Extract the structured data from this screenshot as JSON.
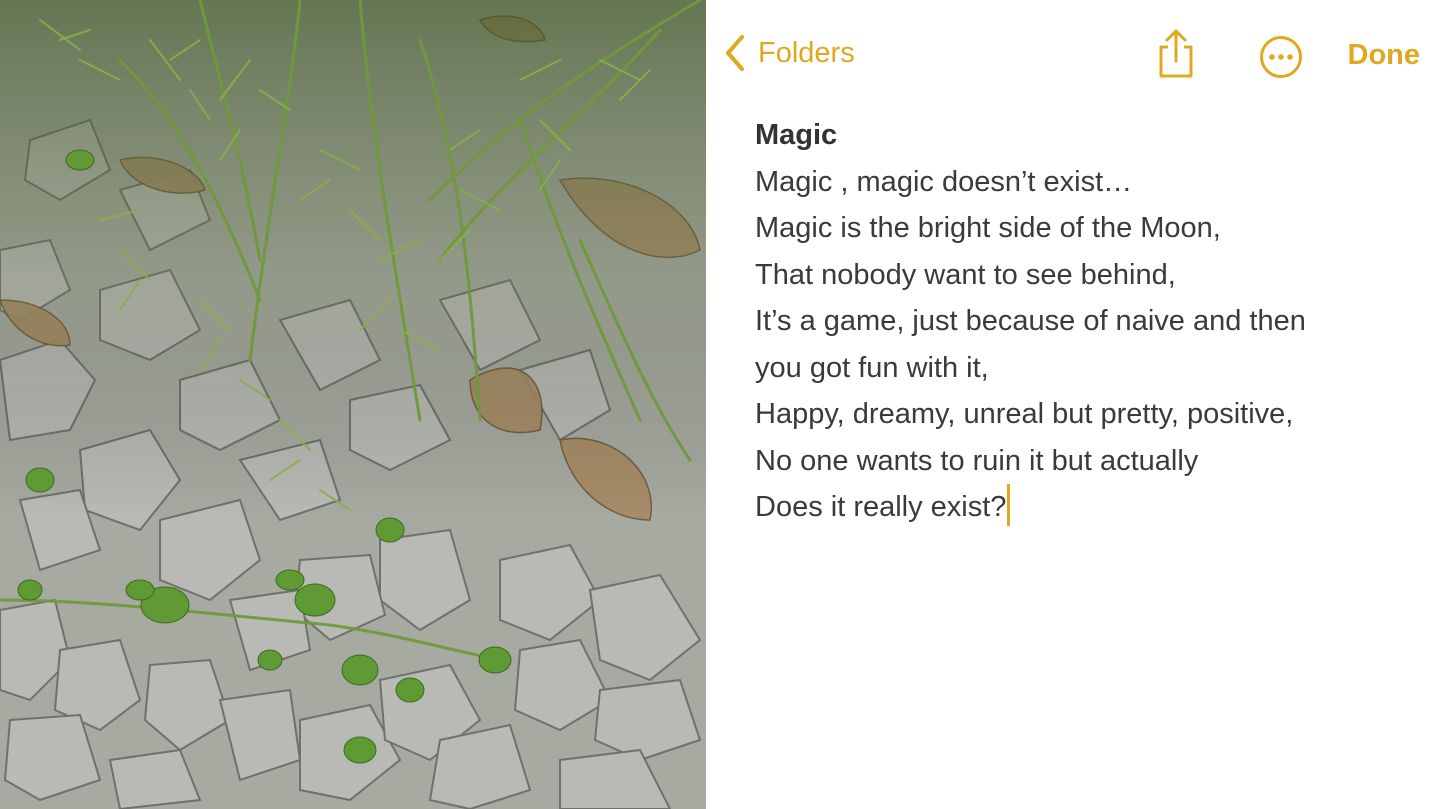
{
  "navigation": {
    "back_label": "Folders",
    "back_icon": "chevron-left-icon",
    "share_icon": "share-icon",
    "more_icon": "ellipsis-circle-icon",
    "done_label": "Done"
  },
  "note": {
    "title": "Magic",
    "lines": [
      "Magic , magic doesn’t exist…",
      "Magic is the bright side of the Moon,",
      "That nobody want to see behind,",
      "It’s a game, just because of naive and then",
      "you got fun with it,",
      "Happy, dreamy, unreal but pretty, positive,",
      "No one wants to ruin it but actually",
      "Does it really exist?"
    ]
  },
  "colors": {
    "accent": "#e0a81f",
    "text": "#3a3a3c",
    "background": "#ffffff"
  }
}
